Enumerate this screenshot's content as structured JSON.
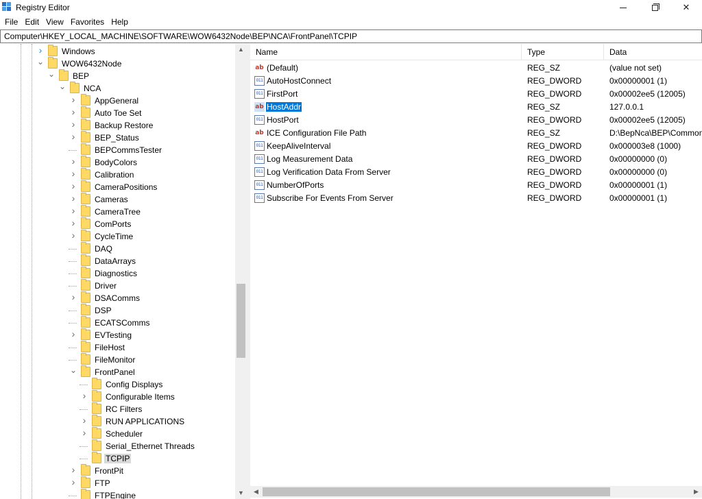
{
  "window": {
    "title": "Registry Editor",
    "controls": {
      "minimize": "",
      "maximize": "",
      "close": "✕"
    }
  },
  "menu": [
    "File",
    "Edit",
    "View",
    "Favorites",
    "Help"
  ],
  "address": "Computer\\HKEY_LOCAL_MACHINE\\SOFTWARE\\WOW6432Node\\BEP\\NCA\\FrontPanel\\TCPIP",
  "tree": [
    {
      "label": "Windows",
      "level": 0,
      "toggle": "collapsed"
    },
    {
      "label": "WOW6432Node",
      "level": 0,
      "toggle": "expanded"
    },
    {
      "label": "BEP",
      "level": 1,
      "toggle": "expanded"
    },
    {
      "label": "NCA",
      "level": 2,
      "toggle": "expanded"
    },
    {
      "label": "AppGeneral",
      "level": 3,
      "toggle": "collapsed"
    },
    {
      "label": "Auto Toe Set",
      "level": 3,
      "toggle": "collapsed"
    },
    {
      "label": "Backup Restore",
      "level": 3,
      "toggle": "collapsed"
    },
    {
      "label": "BEP_Status",
      "level": 3,
      "toggle": "collapsed"
    },
    {
      "label": "BEPCommsTester",
      "level": 3,
      "toggle": "none"
    },
    {
      "label": "BodyColors",
      "level": 3,
      "toggle": "collapsed"
    },
    {
      "label": "Calibration",
      "level": 3,
      "toggle": "collapsed"
    },
    {
      "label": "CameraPositions",
      "level": 3,
      "toggle": "collapsed"
    },
    {
      "label": "Cameras",
      "level": 3,
      "toggle": "collapsed"
    },
    {
      "label": "CameraTree",
      "level": 3,
      "toggle": "collapsed"
    },
    {
      "label": "ComPorts",
      "level": 3,
      "toggle": "collapsed"
    },
    {
      "label": "CycleTime",
      "level": 3,
      "toggle": "collapsed"
    },
    {
      "label": "DAQ",
      "level": 3,
      "toggle": "none"
    },
    {
      "label": "DataArrays",
      "level": 3,
      "toggle": "none"
    },
    {
      "label": "Diagnostics",
      "level": 3,
      "toggle": "none"
    },
    {
      "label": "Driver",
      "level": 3,
      "toggle": "none"
    },
    {
      "label": "DSAComms",
      "level": 3,
      "toggle": "collapsed"
    },
    {
      "label": "DSP",
      "level": 3,
      "toggle": "none"
    },
    {
      "label": "ECATSComms",
      "level": 3,
      "toggle": "none"
    },
    {
      "label": "EVTesting",
      "level": 3,
      "toggle": "collapsed"
    },
    {
      "label": "FileHost",
      "level": 3,
      "toggle": "none"
    },
    {
      "label": "FileMonitor",
      "level": 3,
      "toggle": "none"
    },
    {
      "label": "FrontPanel",
      "level": 3,
      "toggle": "expanded"
    },
    {
      "label": "Config Displays",
      "level": 4,
      "toggle": "none"
    },
    {
      "label": "Configurable Items",
      "level": 4,
      "toggle": "collapsed"
    },
    {
      "label": "RC Filters",
      "level": 4,
      "toggle": "none"
    },
    {
      "label": "RUN APPLICATIONS",
      "level": 4,
      "toggle": "collapsed"
    },
    {
      "label": "Scheduler",
      "level": 4,
      "toggle": "collapsed"
    },
    {
      "label": "Serial_Ethernet Threads",
      "level": 4,
      "toggle": "none"
    },
    {
      "label": "TCPIP",
      "level": 4,
      "toggle": "none",
      "selected": true
    },
    {
      "label": "FrontPit",
      "level": 3,
      "toggle": "collapsed"
    },
    {
      "label": "FTP",
      "level": 3,
      "toggle": "collapsed"
    },
    {
      "label": "FTPEngine",
      "level": 3,
      "toggle": "none"
    }
  ],
  "list": {
    "columns": {
      "name": "Name",
      "type": "Type",
      "data": "Data"
    },
    "rows": [
      {
        "icon": "string-value-icon",
        "name": "(Default)",
        "type": "REG_SZ",
        "data": "(value not set)"
      },
      {
        "icon": "dword-value-icon",
        "name": "AutoHostConnect",
        "type": "REG_DWORD",
        "data": "0x00000001 (1)"
      },
      {
        "icon": "dword-value-icon",
        "name": "FirstPort",
        "type": "REG_DWORD",
        "data": "0x00002ee5 (12005)"
      },
      {
        "icon": "string-value-icon",
        "name": "HostAddr",
        "type": "REG_SZ",
        "data": "127.0.0.1",
        "selected": true
      },
      {
        "icon": "dword-value-icon",
        "name": "HostPort",
        "type": "REG_DWORD",
        "data": "0x00002ee5 (12005)"
      },
      {
        "icon": "string-value-icon",
        "name": "ICE Configuration File Path",
        "type": "REG_SZ",
        "data": "D:\\BepNca\\BEP\\Common"
      },
      {
        "icon": "dword-value-icon",
        "name": "KeepAliveInterval",
        "type": "REG_DWORD",
        "data": "0x000003e8 (1000)"
      },
      {
        "icon": "dword-value-icon",
        "name": "Log Measurement Data",
        "type": "REG_DWORD",
        "data": "0x00000000 (0)"
      },
      {
        "icon": "dword-value-icon",
        "name": "Log Verification Data From Server",
        "type": "REG_DWORD",
        "data": "0x00000000 (0)"
      },
      {
        "icon": "dword-value-icon",
        "name": "NumberOfPorts",
        "type": "REG_DWORD",
        "data": "0x00000001 (1)"
      },
      {
        "icon": "dword-value-icon",
        "name": "Subscribe For Events From Server",
        "type": "REG_DWORD",
        "data": "0x00000001 (1)"
      }
    ]
  },
  "icons": {
    "string": "ab",
    "dword": "011"
  },
  "colors": {
    "selection": "#0078d7",
    "folder": "#ffd966",
    "tree_selection": "#d9d9d9"
  }
}
